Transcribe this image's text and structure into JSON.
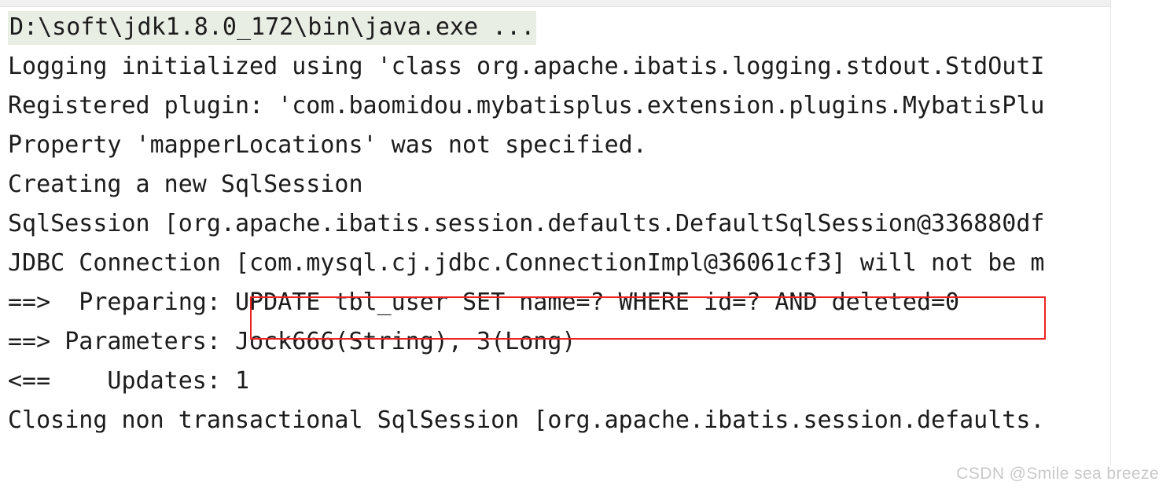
{
  "window": {
    "title": "Run console output"
  },
  "console": {
    "lines": [
      {
        "id": "command-line",
        "text": "D:\\soft\\jdk1.8.0_172\\bin\\java.exe ...",
        "highlighted": true
      },
      {
        "id": "logging-initialized",
        "text": "Logging initialized using 'class org.apache.ibatis.logging.stdout.StdOutI",
        "highlighted": false
      },
      {
        "id": "registered-plugin",
        "text": "Registered plugin: 'com.baomidou.mybatisplus.extension.plugins.MybatisPlu",
        "highlighted": false
      },
      {
        "id": "mapper-locations",
        "text": "Property 'mapperLocations' was not specified.",
        "highlighted": false
      },
      {
        "id": "creating-sqlsession",
        "text": "Creating a new SqlSession",
        "highlighted": false
      },
      {
        "id": "sqlsession-instance",
        "text": "SqlSession [org.apache.ibatis.session.defaults.DefaultSqlSession@336880df",
        "highlighted": false
      },
      {
        "id": "jdbc-connection",
        "text": "JDBC Connection [com.mysql.cj.jdbc.ConnectionImpl@36061cf3] will not be m",
        "highlighted": false
      },
      {
        "id": "preparing",
        "text": "==>  Preparing: UPDATE tbl_user SET name=? WHERE id=? AND deleted=0",
        "highlighted": false
      },
      {
        "id": "parameters",
        "text": "==> Parameters: Jock666(String), 3(Long)",
        "highlighted": false
      },
      {
        "id": "updates",
        "text": "<==    Updates: 1",
        "highlighted": false
      },
      {
        "id": "closing-sqlsession",
        "text": "Closing non transactional SqlSession [org.apache.ibatis.session.defaults.",
        "highlighted": false
      }
    ],
    "sql_annotation": {
      "statement": "UPDATE tbl_user SET name=? WHERE id=? AND deleted=0",
      "box_color": "#ee2222"
    },
    "colors": {
      "background": "#ffffff",
      "text": "#1c1c1c",
      "command_highlight": "#e9eee4",
      "toolbar": "#f0f0f0",
      "border": "#e4e4e4"
    }
  },
  "watermark": {
    "text": "CSDN @Smile sea breeze"
  }
}
